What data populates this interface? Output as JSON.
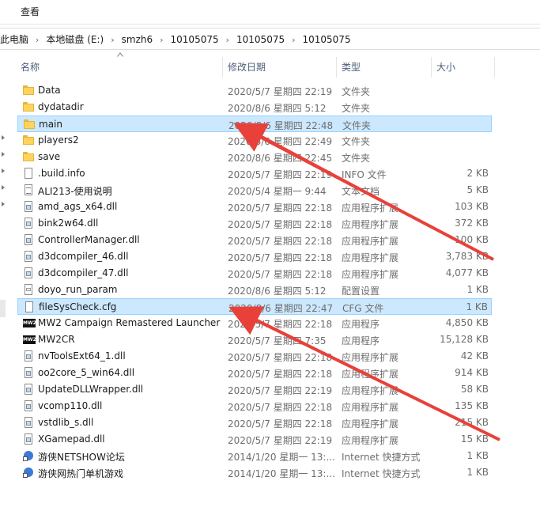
{
  "ribbon": {
    "view_tab": "查看"
  },
  "breadcrumb": [
    "此电脑",
    "本地磁盘 (E:)",
    "smzh6",
    "10105075",
    "10105075",
    "10105075"
  ],
  "columns": {
    "name": "名称",
    "date": "修改日期",
    "type": "类型",
    "size": "大小"
  },
  "files": [
    {
      "name": "Data",
      "date": "2020/5/7 星期四 22:19",
      "type": "文件夹",
      "size": "",
      "icon": "folder-icon",
      "selected": false
    },
    {
      "name": "dydatadir",
      "date": "2020/8/6 星期四 5:12",
      "type": "文件夹",
      "size": "",
      "icon": "folder-icon",
      "selected": false
    },
    {
      "name": "main",
      "date": "2020/8/6 星期四 22:48",
      "type": "文件夹",
      "size": "",
      "icon": "folder-icon",
      "selected": true
    },
    {
      "name": "players2",
      "date": "2020/8/6 星期四 22:49",
      "type": "文件夹",
      "size": "",
      "icon": "folder-icon",
      "selected": false
    },
    {
      "name": "save",
      "date": "2020/8/6 星期四 22:45",
      "type": "文件夹",
      "size": "",
      "icon": "folder-icon",
      "selected": false
    },
    {
      "name": ".build.info",
      "date": "2020/5/7 星期四 22:19",
      "type": "INFO 文件",
      "size": "2 KB",
      "icon": "file-icon",
      "selected": false
    },
    {
      "name": "ALI213-使用说明",
      "date": "2020/5/4 星期一 9:44",
      "type": "文本文档",
      "size": "5 KB",
      "icon": "text-file-icon",
      "selected": false
    },
    {
      "name": "amd_ags_x64.dll",
      "date": "2020/5/7 星期四 22:18",
      "type": "应用程序扩展",
      "size": "103 KB",
      "icon": "dll-file-icon",
      "selected": false
    },
    {
      "name": "bink2w64.dll",
      "date": "2020/5/7 星期四 22:18",
      "type": "应用程序扩展",
      "size": "372 KB",
      "icon": "dll-file-icon",
      "selected": false
    },
    {
      "name": "ControllerManager.dll",
      "date": "2020/5/7 星期四 22:18",
      "type": "应用程序扩展",
      "size": "100 KB",
      "icon": "dll-file-icon",
      "selected": false
    },
    {
      "name": "d3dcompiler_46.dll",
      "date": "2020/5/7 星期四 22:18",
      "type": "应用程序扩展",
      "size": "3,783 KB",
      "icon": "dll-file-icon",
      "selected": false
    },
    {
      "name": "d3dcompiler_47.dll",
      "date": "2020/5/7 星期四 22:18",
      "type": "应用程序扩展",
      "size": "4,077 KB",
      "icon": "dll-file-icon",
      "selected": false
    },
    {
      "name": "doyo_run_param",
      "date": "2020/8/6 星期四 5:12",
      "type": "配置设置",
      "size": "1 KB",
      "icon": "config-file-icon",
      "selected": false
    },
    {
      "name": "fileSysCheck.cfg",
      "date": "2020/8/6 星期四 22:47",
      "type": "CFG 文件",
      "size": "1 KB",
      "icon": "file-icon",
      "selected": true
    },
    {
      "name": "MW2 Campaign Remastered Launcher",
      "date": "2020/5/7 星期四 22:18",
      "type": "应用程序",
      "size": "4,850 KB",
      "icon": "mw2-app-icon",
      "selected": false
    },
    {
      "name": "MW2CR",
      "date": "2020/5/7 星期四 7:35",
      "type": "应用程序",
      "size": "15,128 KB",
      "icon": "mw2-app-icon",
      "selected": false
    },
    {
      "name": "nvToolsExt64_1.dll",
      "date": "2020/5/7 星期四 22:18",
      "type": "应用程序扩展",
      "size": "42 KB",
      "icon": "dll-file-icon",
      "selected": false
    },
    {
      "name": "oo2core_5_win64.dll",
      "date": "2020/5/7 星期四 22:18",
      "type": "应用程序扩展",
      "size": "914 KB",
      "icon": "dll-file-icon",
      "selected": false
    },
    {
      "name": "UpdateDLLWrapper.dll",
      "date": "2020/5/7 星期四 22:19",
      "type": "应用程序扩展",
      "size": "58 KB",
      "icon": "dll-file-icon",
      "selected": false
    },
    {
      "name": "vcomp110.dll",
      "date": "2020/5/7 星期四 22:18",
      "type": "应用程序扩展",
      "size": "135 KB",
      "icon": "dll-file-icon",
      "selected": false
    },
    {
      "name": "vstdlib_s.dll",
      "date": "2020/5/7 星期四 22:18",
      "type": "应用程序扩展",
      "size": "215 KB",
      "icon": "dll-file-icon",
      "selected": false
    },
    {
      "name": "XGamepad.dll",
      "date": "2020/5/7 星期四 22:19",
      "type": "应用程序扩展",
      "size": "15 KB",
      "icon": "dll-file-icon",
      "selected": false
    },
    {
      "name": "游侠NETSHOW论坛",
      "date": "2014/1/20 星期一 13:...",
      "type": "Internet 快捷方式",
      "size": "1 KB",
      "icon": "internet-shortcut-icon",
      "selected": false
    },
    {
      "name": "游侠网热门单机游戏",
      "date": "2014/1/20 星期一 13:...",
      "type": "Internet 快捷方式",
      "size": "1 KB",
      "icon": "internet-shortcut-icon",
      "selected": false
    }
  ],
  "colors": {
    "selection": "#cce8ff",
    "selection_border": "#99d1ff",
    "annotation_arrow": "#e8413a",
    "folder": "#ffd35c",
    "header_text": "#4c607a"
  }
}
